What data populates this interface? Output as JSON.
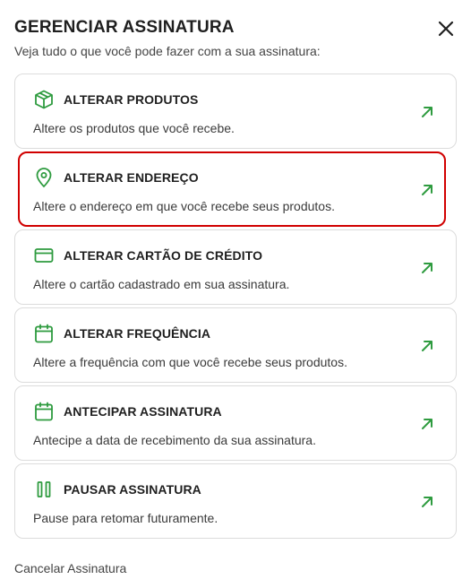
{
  "header": {
    "title": "GERENCIAR ASSINATURA",
    "subtitle": "Veja tudo o que você pode fazer com a sua assinatura:"
  },
  "colors": {
    "accent": "#2e9b3f",
    "highlight_border": "#d10000",
    "card_border": "#dcdcdc"
  },
  "options": [
    {
      "icon": "box-icon",
      "title": "ALTERAR PRODUTOS",
      "description": "Altere os produtos que você recebe."
    },
    {
      "icon": "location-pin-icon",
      "title": "ALTERAR ENDEREÇO",
      "description": "Altere o endereço em que você recebe seus produtos."
    },
    {
      "icon": "credit-card-icon",
      "title": "ALTERAR CARTÃO DE CRÉDITO",
      "description": "Altere o cartão cadastrado em sua assinatura."
    },
    {
      "icon": "calendar-icon",
      "title": "ALTERAR FREQUÊNCIA",
      "description": "Altere a frequência com que você recebe seus produtos."
    },
    {
      "icon": "calendar-icon",
      "title": "ANTECIPAR ASSINATURA",
      "description": "Antecipe a data de recebimento da sua assinatura."
    },
    {
      "icon": "pause-icon",
      "title": "PAUSAR ASSINATURA",
      "description": "Pause para retomar futuramente."
    }
  ],
  "footer": {
    "cancel_label": "Cancelar Assinatura"
  }
}
